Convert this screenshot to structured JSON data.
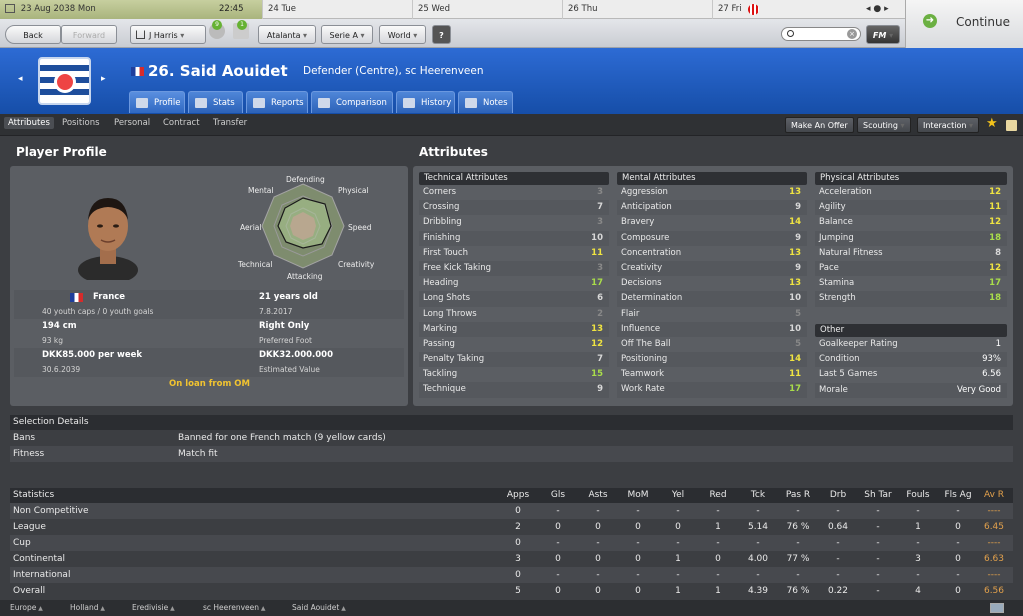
{
  "calendar": {
    "today": "23 Aug 2038",
    "today_day": "Mon",
    "time": "22:45",
    "days": [
      "24 Tue",
      "25 Wed",
      "26 Thu",
      "27 Fri"
    ]
  },
  "nav": {
    "back": "Back",
    "forward": "Forward",
    "manager": "J Harris",
    "team": "Atalanta",
    "league": "Serie A",
    "world": "World",
    "help": "?",
    "badge1": "9",
    "badge2": "1",
    "continue": "Continue",
    "fm": "FM"
  },
  "player": {
    "number_name": "26. Said Aouidet",
    "role": "Defender (Centre), sc Heerenveen"
  },
  "tabs": [
    "Profile",
    "Stats",
    "Reports",
    "Comparison",
    "History",
    "Notes"
  ],
  "subnav": {
    "items": [
      "Attributes",
      "Positions",
      "Personal",
      "Contract",
      "Transfer"
    ],
    "make_offer": "Make An Offer",
    "scouting": "Scouting",
    "interaction": "Interaction"
  },
  "profile": {
    "title": "Player Profile",
    "radar": [
      "Defending",
      "Physical",
      "Speed",
      "Creativity",
      "Attacking",
      "Technical",
      "Aerial",
      "Mental"
    ],
    "nation": "France",
    "caps": "40 youth caps / 0 youth goals",
    "age": "21 years old",
    "dob": "7.8.2017",
    "height": "194 cm",
    "weight": "93 kg",
    "foot": "Right Only",
    "foot_label": "Preferred Foot",
    "wage": "DKK85.000 per week",
    "contract_end": "30.6.2039",
    "value": "DKK32.000.000",
    "value_label": "Estimated Value",
    "loan": "On loan from OM"
  },
  "attributes": {
    "title": "Attributes",
    "technical": {
      "header": "Technical Attributes",
      "rows": [
        [
          "Corners",
          "3"
        ],
        [
          "Crossing",
          "7"
        ],
        [
          "Dribbling",
          "3"
        ],
        [
          "Finishing",
          "10"
        ],
        [
          "First Touch",
          "11"
        ],
        [
          "Free Kick Taking",
          "3"
        ],
        [
          "Heading",
          "17"
        ],
        [
          "Long Shots",
          "6"
        ],
        [
          "Long Throws",
          "2"
        ],
        [
          "Marking",
          "13"
        ],
        [
          "Passing",
          "12"
        ],
        [
          "Penalty Taking",
          "7"
        ],
        [
          "Tackling",
          "15"
        ],
        [
          "Technique",
          "9"
        ]
      ]
    },
    "mental": {
      "header": "Mental Attributes",
      "rows": [
        [
          "Aggression",
          "13"
        ],
        [
          "Anticipation",
          "9"
        ],
        [
          "Bravery",
          "14"
        ],
        [
          "Composure",
          "9"
        ],
        [
          "Concentration",
          "13"
        ],
        [
          "Creativity",
          "9"
        ],
        [
          "Decisions",
          "13"
        ],
        [
          "Determination",
          "10"
        ],
        [
          "Flair",
          "5"
        ],
        [
          "Influence",
          "10"
        ],
        [
          "Off The Ball",
          "5"
        ],
        [
          "Positioning",
          "14"
        ],
        [
          "Teamwork",
          "11"
        ],
        [
          "Work Rate",
          "17"
        ]
      ]
    },
    "physical": {
      "header": "Physical Attributes",
      "rows": [
        [
          "Acceleration",
          "12"
        ],
        [
          "Agility",
          "11"
        ],
        [
          "Balance",
          "12"
        ],
        [
          "Jumping",
          "18"
        ],
        [
          "Natural Fitness",
          "8"
        ],
        [
          "Pace",
          "12"
        ],
        [
          "Stamina",
          "17"
        ],
        [
          "Strength",
          "18"
        ]
      ]
    },
    "other": {
      "header": "Other",
      "rows": [
        [
          "Goalkeeper Rating",
          "1"
        ],
        [
          "Condition",
          "93%"
        ],
        [
          "Last 5 Games",
          "6.56"
        ],
        [
          "Morale",
          "Very Good"
        ]
      ]
    }
  },
  "selection": {
    "header": "Selection Details",
    "rows": [
      [
        "Bans",
        "Banned for one French match (9 yellow cards)"
      ],
      [
        "Fitness",
        "Match fit"
      ]
    ]
  },
  "statistics": {
    "header": "Statistics",
    "columns": [
      "Apps",
      "Gls",
      "Asts",
      "MoM",
      "Yel",
      "Red",
      "Tck",
      "Pas R",
      "Drb",
      "Sh Tar",
      "Fouls",
      "Fls Ag",
      "Av R"
    ],
    "rows": [
      {
        "name": "Non Competitive",
        "values": [
          "0",
          "-",
          "-",
          "-",
          "-",
          "-",
          "-",
          "-",
          "-",
          "-",
          "-",
          "-",
          "----"
        ]
      },
      {
        "name": "League",
        "values": [
          "2",
          "0",
          "0",
          "0",
          "0",
          "1",
          "5.14",
          "76 %",
          "0.64",
          "-",
          "1",
          "0",
          "6.45"
        ]
      },
      {
        "name": "Cup",
        "values": [
          "0",
          "-",
          "-",
          "-",
          "-",
          "-",
          "-",
          "-",
          "-",
          "-",
          "-",
          "-",
          "----"
        ]
      },
      {
        "name": "Continental",
        "values": [
          "3",
          "0",
          "0",
          "0",
          "1",
          "0",
          "4.00",
          "77 %",
          "-",
          "-",
          "3",
          "0",
          "6.63"
        ]
      },
      {
        "name": "International",
        "values": [
          "0",
          "-",
          "-",
          "-",
          "-",
          "-",
          "-",
          "-",
          "-",
          "-",
          "-",
          "-",
          "----"
        ]
      },
      {
        "name": "Overall",
        "values": [
          "5",
          "0",
          "0",
          "0",
          "1",
          "1",
          "4.39",
          "76 %",
          "0.22",
          "-",
          "4",
          "0",
          "6.56"
        ]
      }
    ]
  },
  "footer": {
    "crumbs": [
      "Europe",
      "Holland",
      "Eredivisie",
      "sc Heerenveen",
      "Said Aouidet"
    ]
  }
}
